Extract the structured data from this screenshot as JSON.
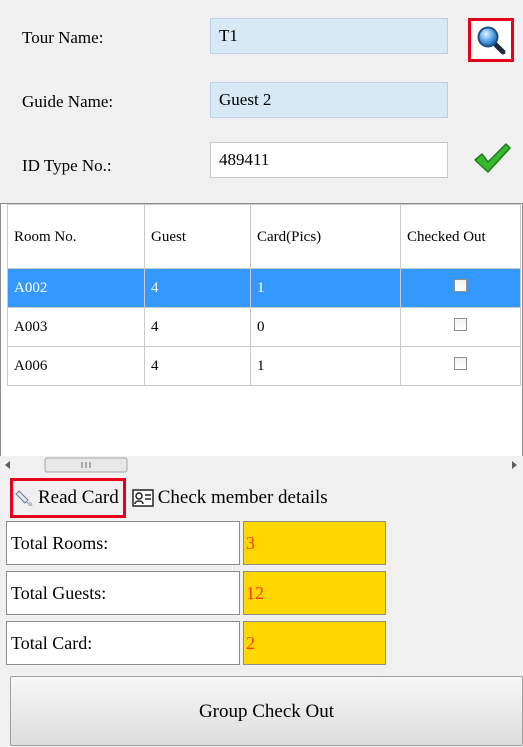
{
  "form": {
    "tour_name_label": "Tour Name:",
    "tour_name_value": "T1",
    "guide_name_label": "Guide Name:",
    "guide_name_value": "Guest 2",
    "id_type_label": "ID Type No.:",
    "id_type_value": "489411",
    "search_icon": "magnifier-icon",
    "verify_icon": "green-checkmark-icon"
  },
  "table": {
    "headers": [
      "Room No.",
      "Guest",
      "Card(Pics)",
      "Checked Out"
    ],
    "rows": [
      {
        "room": "A002",
        "guest": "4",
        "card": "1",
        "checked_out": false,
        "selected": true
      },
      {
        "room": "A003",
        "guest": "4",
        "card": "0",
        "checked_out": false,
        "selected": false
      },
      {
        "room": "A006",
        "guest": "4",
        "card": "1",
        "checked_out": false,
        "selected": false
      }
    ],
    "selection_color": "#3399ff"
  },
  "actions": {
    "read_card_label": "Read Card",
    "check_member_label": "Check member details"
  },
  "summary": {
    "total_rooms_label": "Total Rooms:",
    "total_rooms_value": "3",
    "total_guests_label": "Total Guests:",
    "total_guests_value": "12",
    "total_card_label": "Total Card:",
    "total_card_value": "2",
    "value_bg_color": "#ffd700",
    "value_text_color": "#ff3b00"
  },
  "footer": {
    "group_checkout_label": "Group Check Out"
  },
  "colors": {
    "highlight_border": "#e8001a",
    "readonly_field_bg": "#d6e9f5"
  }
}
